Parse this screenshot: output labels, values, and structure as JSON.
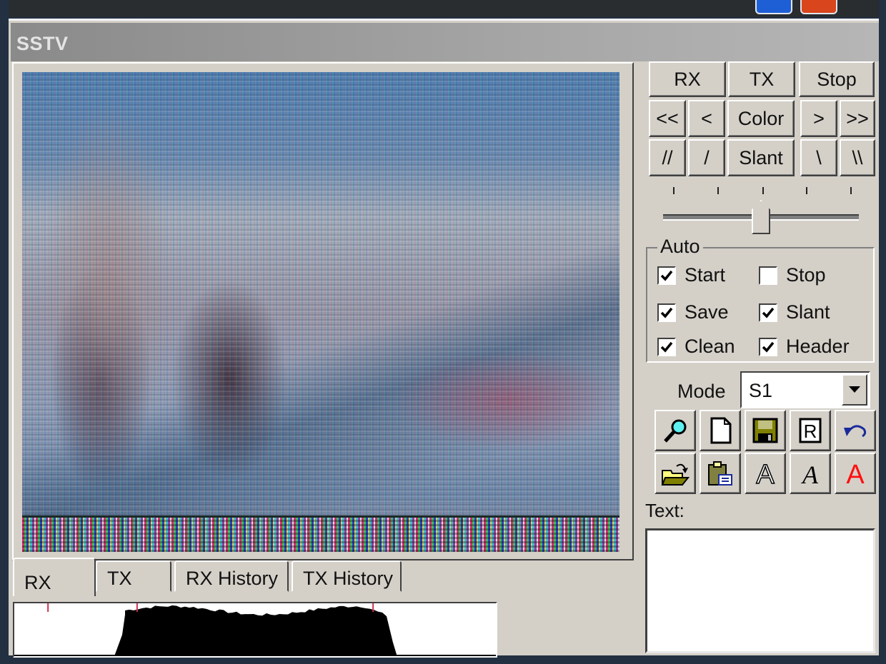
{
  "window": {
    "title": "SSTV"
  },
  "controls": {
    "row1": [
      "RX",
      "TX",
      "Stop"
    ],
    "row2": [
      "<<",
      "<",
      "Color",
      ">",
      ">>"
    ],
    "row3": [
      "//",
      "/",
      "Slant",
      "\\",
      "\\\\"
    ]
  },
  "slider": {
    "tick_count": 5,
    "value_position": 0.5
  },
  "auto": {
    "label": "Auto",
    "options": [
      {
        "label": "Start",
        "checked": true
      },
      {
        "label": "Stop",
        "checked": false
      },
      {
        "label": "Save",
        "checked": true
      },
      {
        "label": "Slant",
        "checked": true
      },
      {
        "label": "Clean",
        "checked": true
      },
      {
        "label": "Header",
        "checked": true
      }
    ]
  },
  "mode": {
    "label": "Mode",
    "selected": "S1"
  },
  "toolbar_icons": [
    "magnifier-icon",
    "new-document-icon",
    "save-disk-icon",
    "r-box-icon",
    "undo-icon",
    "open-folder-icon",
    "paste-clipboard-icon",
    "outline-font-icon",
    "italic-font-icon",
    "red-font-icon"
  ],
  "text_box": {
    "label": "Text:",
    "value": ""
  },
  "tabs": [
    {
      "label": "RX",
      "active": true
    },
    {
      "label": "TX",
      "active": false
    },
    {
      "label": "RX History",
      "active": false
    },
    {
      "label": "TX History",
      "active": false
    }
  ],
  "spectrum": {
    "markers": [
      0.07,
      0.255,
      0.745
    ],
    "band_start": 0.23,
    "band_end": 0.78
  },
  "colors": {
    "face": "#d4d0c8",
    "marker": "#d03050",
    "desktop": "#223042"
  }
}
